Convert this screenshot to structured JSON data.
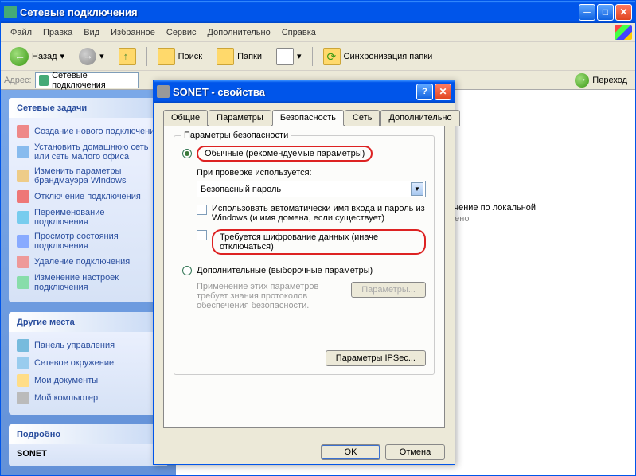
{
  "mainWindow": {
    "title": "Сетевые подключения",
    "menu": [
      "Файл",
      "Правка",
      "Вид",
      "Избранное",
      "Сервис",
      "Дополнительно",
      "Справка"
    ],
    "toolbar": {
      "back": "Назад",
      "search": "Поиск",
      "folders": "Папки",
      "sync": "Синхронизация папки"
    },
    "addressLabel": "Адрес:",
    "addressValue": "Сетевые подключения",
    "goLabel": "Переход"
  },
  "sidebar": {
    "tasks": {
      "title": "Сетевые задачи",
      "items": [
        "Создание нового подключения",
        "Установить домашнюю сеть или сеть малого офиса",
        "Изменить параметры брандмауэра Windows",
        "Отключение подключения",
        "Переименование подключения",
        "Просмотр состояния подключения",
        "Удаление подключения",
        "Изменение настроек подключения"
      ]
    },
    "places": {
      "title": "Другие места",
      "items": [
        "Панель управления",
        "Сетевое окружение",
        "Мои документы",
        "Мой компьютер"
      ]
    },
    "details": {
      "title": "Подробно",
      "item": "SONET"
    }
  },
  "mainContent": {
    "connName": "ключение по локальной",
    "connStatus": "лючено"
  },
  "dialog": {
    "title": "SONET - свойства",
    "tabs": [
      "Общие",
      "Параметры",
      "Безопасность",
      "Сеть",
      "Дополнительно"
    ],
    "activeTab": 2,
    "group": {
      "legend": "Параметры безопасности",
      "radioTypical": "Обычные (рекомендуемые параметры)",
      "validateLabel": "При проверке используется:",
      "validateValue": "Безопасный пароль",
      "chkAuto": "Использовать автоматически имя входа и пароль из Windows (и имя домена, если существует)",
      "chkEncrypt": "Требуется шифрование данных (иначе отключаться)",
      "radioAdvanced": "Дополнительные (выборочные параметры)",
      "advNote": "Применение этих параметров требует знания протоколов обеспечения безопасности.",
      "btnParams": "Параметры...",
      "btnIpsec": "Параметры IPSec..."
    },
    "ok": "OK",
    "cancel": "Отмена"
  }
}
